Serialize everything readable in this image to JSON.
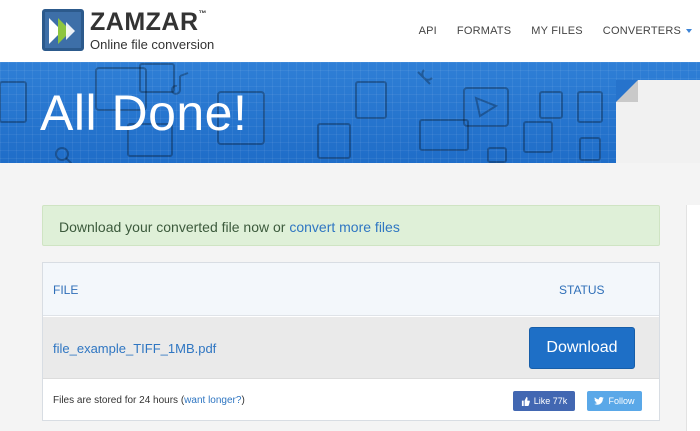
{
  "header": {
    "brand": "ZAMZAR",
    "brand_tm": "™",
    "tagline": "Online file conversion",
    "nav": [
      "API",
      "FORMATS",
      "MY FILES",
      "CONVERTERS"
    ]
  },
  "banner": {
    "title": "All Done!"
  },
  "alert": {
    "text": "Download your converted file now or ",
    "link": "convert more files"
  },
  "table": {
    "col_file": "FILE",
    "col_status": "STATUS",
    "file_name": "file_example_TIFF_1MB.pdf",
    "download_label": "Download"
  },
  "footer": {
    "text": "Files are stored for 24 hours (",
    "link": "want longer?",
    "text_end": ")",
    "like_label": "Like 77k",
    "follow_label": "Follow"
  },
  "colors": {
    "brand_blue": "#1e6fc6",
    "banner_blue": "#2f7fd6",
    "alert_green": "#dff0d8",
    "facebook": "#4267b2",
    "twitter": "#5aa8e8"
  }
}
